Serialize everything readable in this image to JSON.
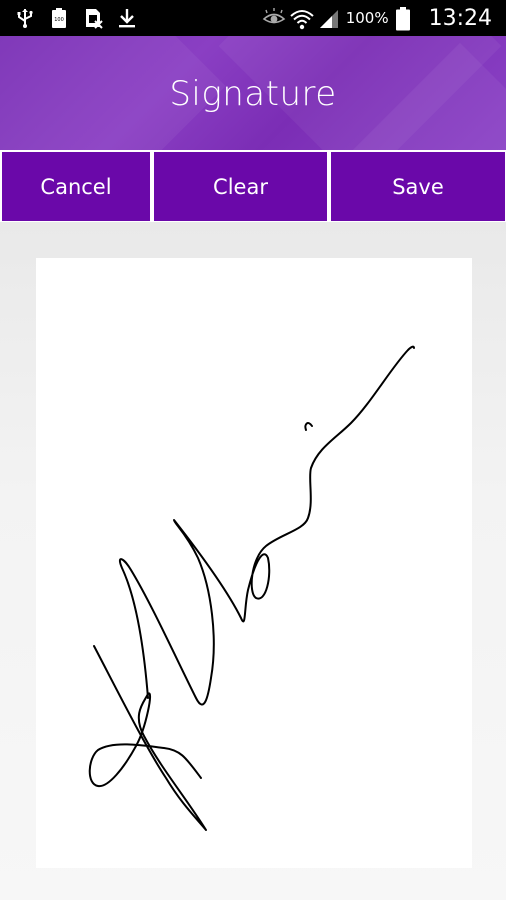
{
  "status_bar": {
    "icons": [
      "usb-icon",
      "battery-100-icon",
      "sim-missing-icon",
      "download-icon",
      "eye-icon",
      "wifi-icon",
      "signal-icon",
      "battery-icon"
    ],
    "battery_percent": "100%",
    "time": "13:24"
  },
  "header": {
    "title": "Signature",
    "background_color": "#7b2db5"
  },
  "toolbar": {
    "cancel_label": "Cancel",
    "clear_label": "Clear",
    "save_label": "Save",
    "button_color": "#6a08a9"
  },
  "signature_pad": {
    "has_signature": true,
    "stroke_color": "#000000"
  }
}
